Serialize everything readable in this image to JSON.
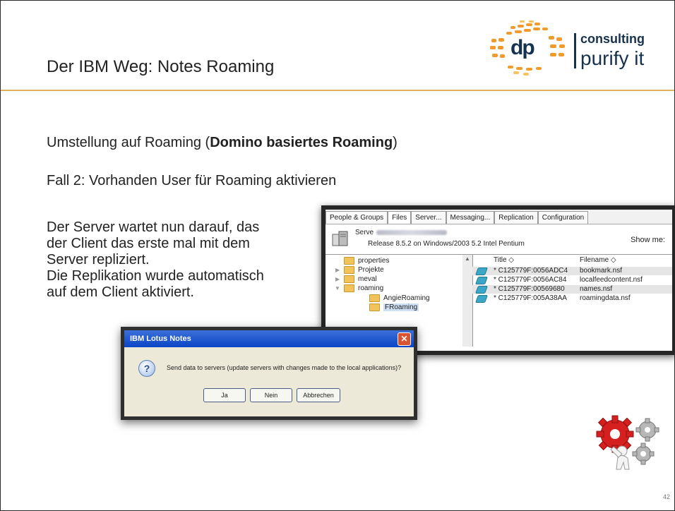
{
  "slide": {
    "title": "Der IBM Weg: Notes Roaming",
    "logo": {
      "dp": "dp",
      "consulting": "consulting",
      "purify": "purify it"
    },
    "subhead_prefix": "Umstellung auf Roaming (",
    "subhead_bold": "Domino basiertes Roaming",
    "subhead_suffix": ")",
    "case_line": "Fall 2: Vorhanden User für Roaming aktivieren",
    "body_lines": [
      "Der Server wartet nun darauf, das",
      "der Client das erste mal mit dem",
      "Server repliziert.",
      "Die Replikation wurde automatisch",
      "auf dem Client aktiviert."
    ],
    "page_number": "42"
  },
  "admin": {
    "tabs": [
      "People & Groups",
      "Files",
      "Server...",
      "Messaging...",
      "Replication",
      "Configuration"
    ],
    "server_label": "Serve",
    "release_text": "Release 8.5.2 on Windows/2003 5.2 Intel Pentium",
    "show_me": "Show me:",
    "tree": [
      "properties",
      "Projekte",
      "meval",
      "roaming",
      "AngieRoaming",
      "FRoaming"
    ],
    "columns": {
      "title": "Title ◇",
      "filename": "Filename ◇"
    },
    "files": [
      {
        "title": "* C125779F:0056ADC4",
        "filename": "bookmark.nsf"
      },
      {
        "title": "* C125779F:0056AC84",
        "filename": "localfeedcontent.nsf"
      },
      {
        "title": "* C125779F:00569680",
        "filename": "names.nsf"
      },
      {
        "title": "* C125779F:005A38AA",
        "filename": "roamingdata.nsf"
      }
    ]
  },
  "dialog": {
    "title": "IBM Lotus Notes",
    "message": "Send data to servers (update servers with changes made to the local applications)?",
    "buttons": {
      "yes": "Ja",
      "no": "Nein",
      "cancel": "Abbrechen"
    }
  }
}
